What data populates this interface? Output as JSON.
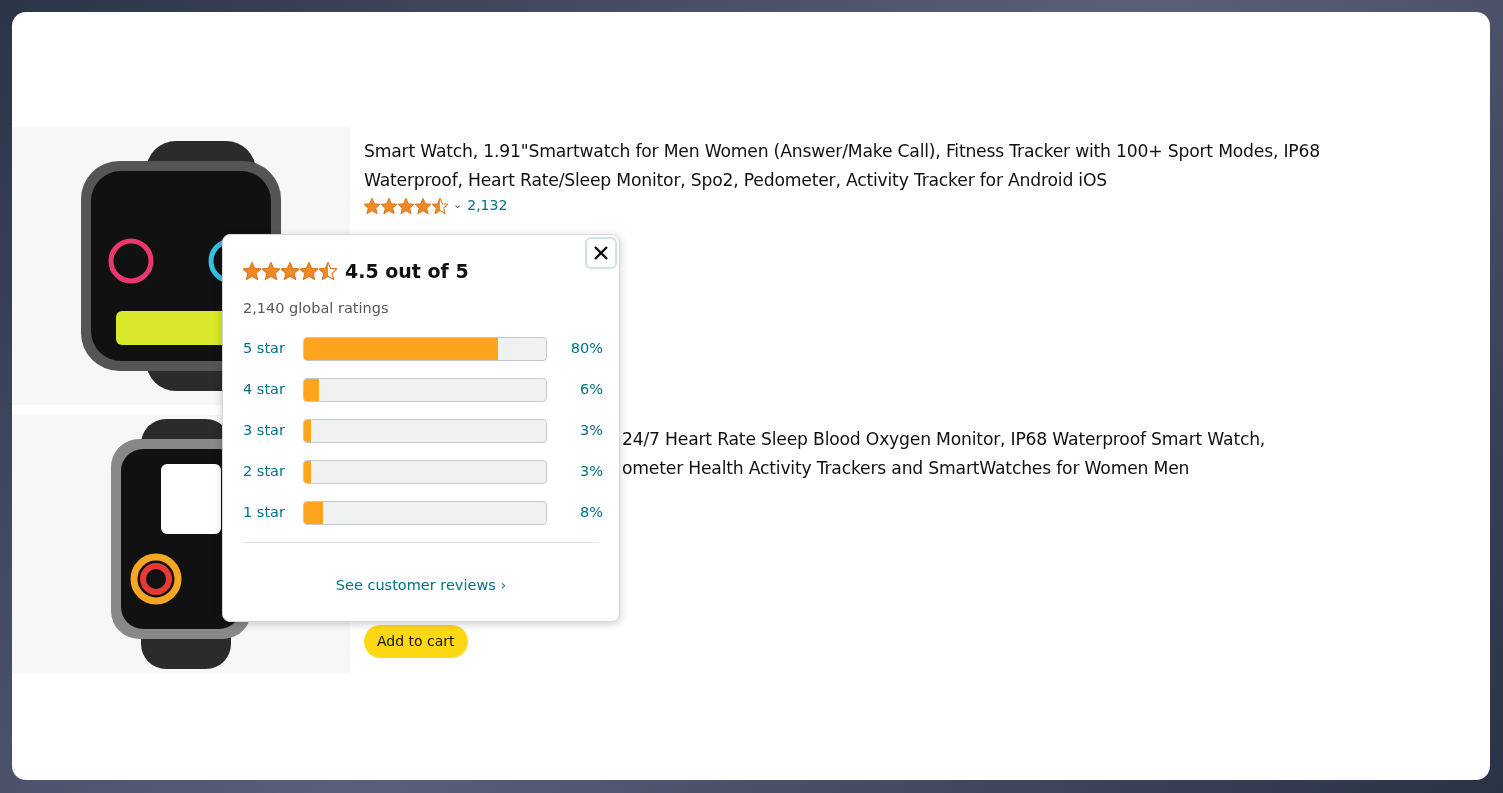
{
  "products": [
    {
      "kind": "full",
      "title": "Smart Watch, 1.91\"Smartwatch for Men Women (Answer/Make Call), Fitness Tracker with 100+ Sport Modes, IP68 Waterproof, Heart Rate/Sleep Monitor, Spo2, Pedometer, Activity Tracker for Android iOS",
      "stars": 4.5,
      "caret": "⌄",
      "rating_count": "2,132"
    },
    {
      "kind": "covered",
      "title_lines": [
        "24/7 Heart Rate Sleep Blood Oxygen Monitor, IP68 Waterproof Smart Watch,",
        "ometer Health Activity Trackers and SmartWatches for Women Men"
      ],
      "button": "Add to cart"
    }
  ],
  "popover": {
    "stars": 4.5,
    "heading": "4.5 out of 5",
    "global_ratings": "2,140 global ratings",
    "histogram": [
      {
        "label": "5 star",
        "level": 0.8,
        "percent": "80%"
      },
      {
        "label": "4 star",
        "level": 0.06,
        "percent": "6%"
      },
      {
        "label": "3 star",
        "level": 0.03,
        "percent": "3%"
      },
      {
        "label": "2 star",
        "level": 0.03,
        "percent": "3%"
      },
      {
        "label": "1 star",
        "level": 0.08,
        "percent": "8%"
      }
    ],
    "link": "See customer reviews ›"
  }
}
